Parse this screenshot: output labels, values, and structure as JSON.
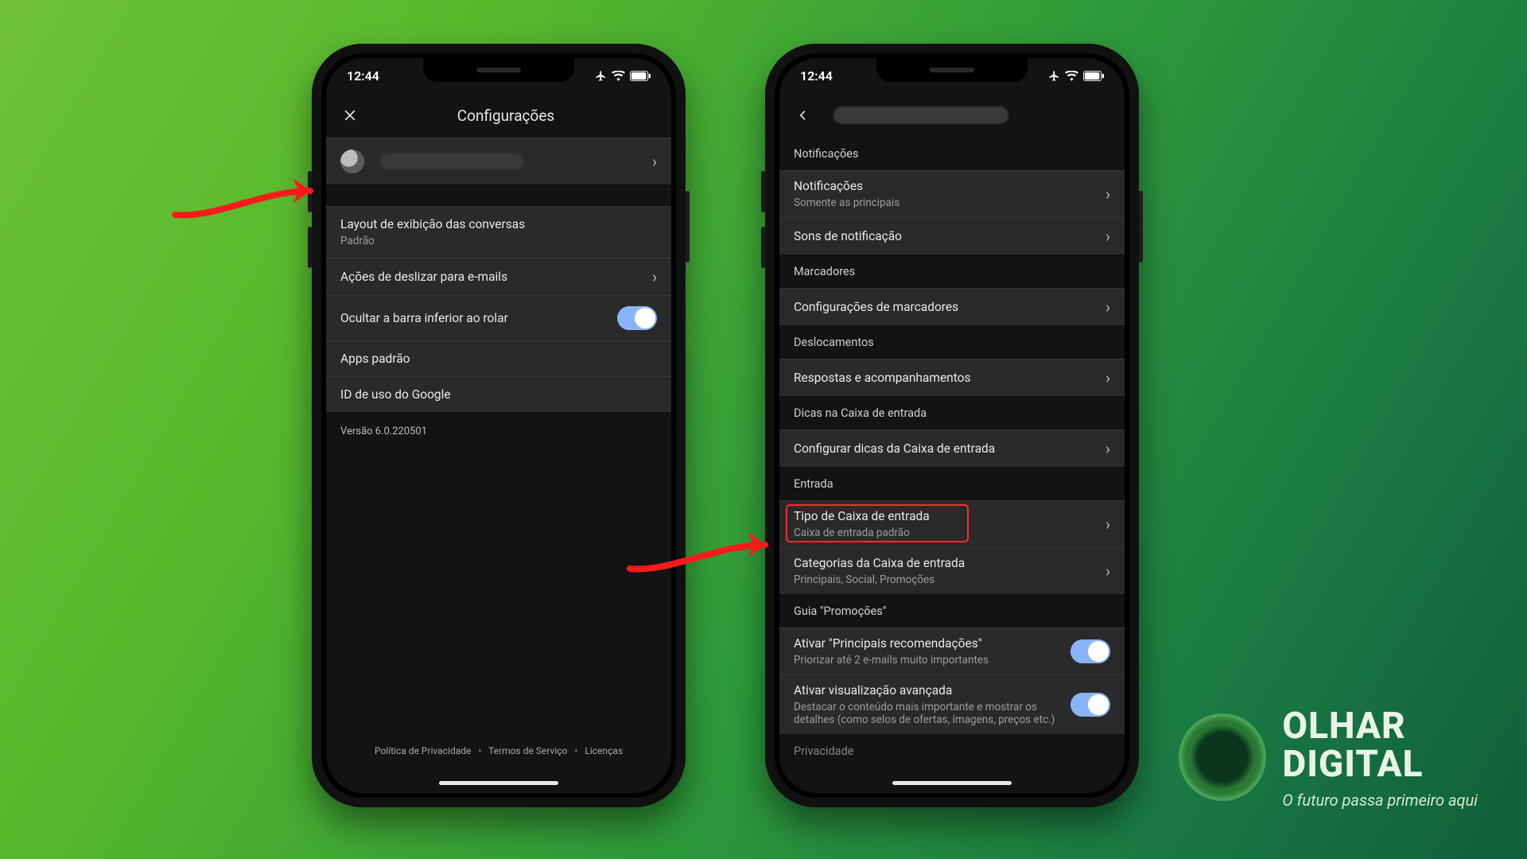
{
  "status": {
    "time": "12:44"
  },
  "phone1": {
    "header_title": "Configurações",
    "rows": {
      "layout_title": "Layout de exibição das conversas",
      "layout_sub": "Padrão",
      "swipe": "Ações de deslizar para e-mails",
      "hide_bottom": "Ocultar a barra inferior ao rolar",
      "default_apps": "Apps padrão",
      "google_id": "ID de uso do Google"
    },
    "version": "Versão 6.0.220501",
    "footer": {
      "privacy": "Política de Privacidade",
      "terms": "Termos de Serviço",
      "licenses": "Licenças"
    }
  },
  "phone2": {
    "sections": {
      "notifications": "Notificações",
      "markers": "Marcadores",
      "movements": "Deslocamentos",
      "inbox_tips": "Dicas na Caixa de entrada",
      "inbox": "Entrada",
      "promos_guide": "Guia \"Promoções\"",
      "privacy": "Privacidade"
    },
    "rows": {
      "notifications_title": "Notificações",
      "notifications_sub": "Somente as principais",
      "sounds": "Sons de notificação",
      "marker_settings": "Configurações de marcadores",
      "followups": "Respostas e acompanhamentos",
      "configure_tips": "Configurar dicas da Caixa de entrada",
      "inbox_type_title": "Tipo de Caixa de entrada",
      "inbox_type_sub": "Caixa de entrada padrão",
      "categories_title": "Categorias da Caixa de entrada",
      "categories_sub": "Principais, Social, Promoções",
      "top_recs_title": "Ativar \"Principais recomendações\"",
      "top_recs_sub": "Priorizar até 2 e-mails muito importantes",
      "enhanced_title": "Ativar visualização avançada",
      "enhanced_sub": "Destacar o conteúdo mais importante e mostrar os detalhes (como selos de ofertas, imagens, preços etc.)"
    }
  },
  "brand": {
    "line1": "OLHAR",
    "line2": "DIGITAL",
    "tag": "O futuro passa primeiro aqui"
  }
}
